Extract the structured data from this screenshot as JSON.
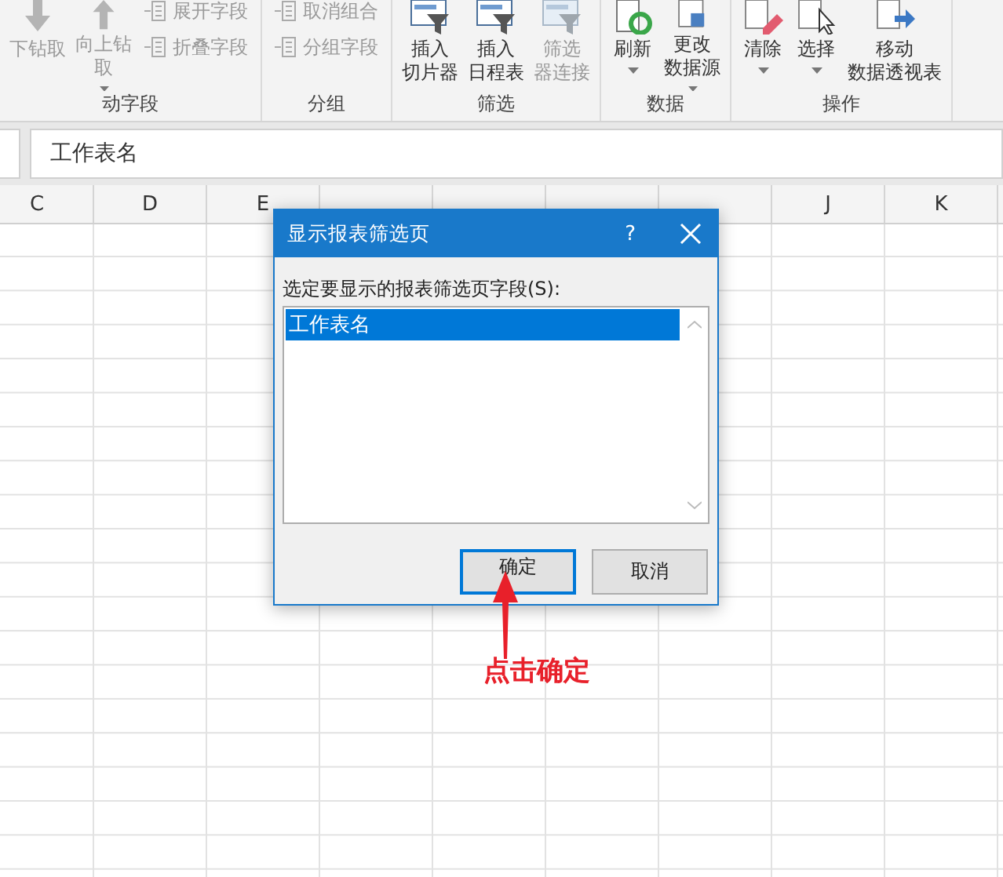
{
  "ribbon": {
    "groups": [
      {
        "label": "动字段",
        "buttons": [
          {
            "kind": "large",
            "lines": [
              "下钻取"
            ],
            "dropdown": false,
            "disabled": true
          },
          {
            "kind": "large",
            "lines": [
              "向上钻",
              "取"
            ],
            "dropdown": true,
            "disabled": true
          },
          {
            "kind": "stack",
            "items": [
              {
                "label": "展开字段",
                "disabled": true
              },
              {
                "label": "折叠字段",
                "disabled": true
              }
            ]
          }
        ]
      },
      {
        "label": "分组",
        "buttons": [
          {
            "kind": "stack",
            "items": [
              {
                "label": "取消组合",
                "disabled": true
              },
              {
                "label": "分组字段",
                "disabled": true
              }
            ]
          }
        ]
      },
      {
        "label": "筛选",
        "buttons": [
          {
            "kind": "large",
            "lines": [
              "插入",
              "切片器"
            ],
            "dropdown": false,
            "disabled": false
          },
          {
            "kind": "large",
            "lines": [
              "插入",
              "日程表"
            ],
            "dropdown": false,
            "disabled": false
          },
          {
            "kind": "large",
            "lines": [
              "筛选",
              "器连接"
            ],
            "dropdown": false,
            "disabled": true
          }
        ]
      },
      {
        "label": "数据",
        "buttons": [
          {
            "kind": "large",
            "lines": [
              "刷新"
            ],
            "dropdown": true,
            "disabled": false
          },
          {
            "kind": "large",
            "lines": [
              "更改",
              "数据源"
            ],
            "dropdown": true,
            "disabled": false
          }
        ]
      },
      {
        "label": "操作",
        "buttons": [
          {
            "kind": "large",
            "lines": [
              "清除"
            ],
            "dropdown": true,
            "disabled": false
          },
          {
            "kind": "large",
            "lines": [
              "选择"
            ],
            "dropdown": true,
            "disabled": false
          },
          {
            "kind": "large",
            "lines": [
              "移动",
              "数据透视表"
            ],
            "dropdown": false,
            "disabled": false
          }
        ]
      }
    ]
  },
  "formula_bar": {
    "value": "工作表名"
  },
  "columns": [
    {
      "label": "C"
    },
    {
      "label": "D"
    },
    {
      "label": "E"
    },
    {
      "label": "J"
    },
    {
      "label": "K"
    }
  ],
  "dialog": {
    "title": "显示报表筛选页",
    "help": "?",
    "prompt": "选定要显示的报表筛选页字段(S):",
    "items": [
      {
        "label": "工作表名",
        "selected": true
      }
    ],
    "buttons": [
      {
        "label": "确定",
        "default": true
      },
      {
        "label": "取消",
        "default": false
      }
    ]
  },
  "annotation": {
    "text": "点击确定"
  }
}
